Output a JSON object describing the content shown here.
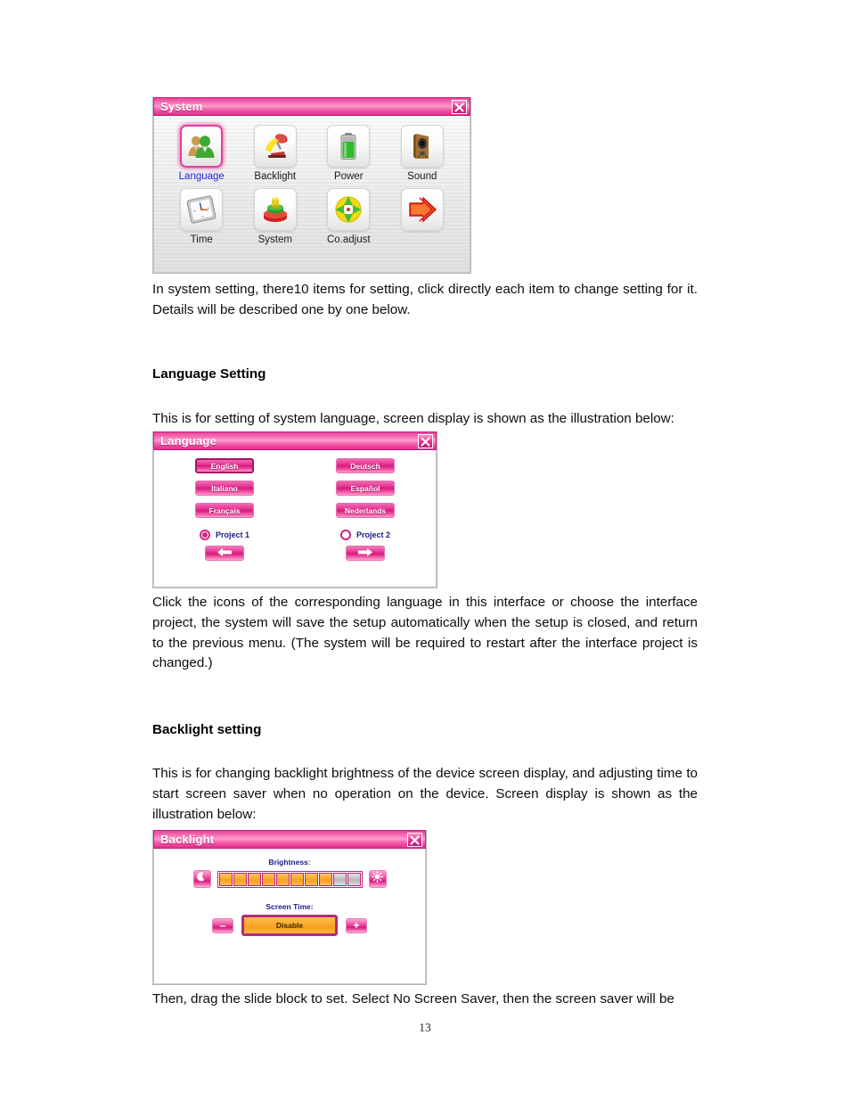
{
  "document": {
    "page_number": "13"
  },
  "system_dialog": {
    "title": "System",
    "close_label": "×",
    "items": [
      {
        "label": "Language",
        "icon": "people-icon",
        "selected": true,
        "highlight": true
      },
      {
        "label": "Backlight",
        "icon": "desk-lamp-icon",
        "selected": false,
        "highlight": false
      },
      {
        "label": "Power",
        "icon": "battery-icon",
        "selected": false,
        "highlight": false
      },
      {
        "label": "Sound",
        "icon": "speaker-icon",
        "selected": false,
        "highlight": false
      },
      {
        "label": "Time",
        "icon": "clock-icon",
        "selected": false,
        "highlight": false
      },
      {
        "label": "System",
        "icon": "stacked-disks-icon",
        "selected": false,
        "highlight": false
      },
      {
        "label": "Co.adjust",
        "icon": "compass-cross-icon",
        "selected": false,
        "highlight": false
      },
      {
        "label": "",
        "icon": "next-arrow-icon",
        "selected": false,
        "highlight": false
      }
    ]
  },
  "paragraph_system": "In system setting, there10 items for setting, click directly each item to change setting for it. Details will be described one by one below.",
  "language_section": {
    "heading": "Language Setting",
    "intro": "This is for setting of system language, screen display is shown as the illustration below:",
    "after": "Click the icons of the corresponding language in this interface or choose the interface project, the system will save the setup automatically when the setup is closed, and return to the previous menu. (The system will be required to restart after the interface project is changed.)"
  },
  "language_dialog": {
    "title": "Language",
    "close_label": "×",
    "buttons": [
      {
        "label": "English",
        "selected": true
      },
      {
        "label": "Deutsch",
        "selected": false
      },
      {
        "label": "Italiano",
        "selected": false
      },
      {
        "label": "Español",
        "selected": false
      },
      {
        "label": "Français",
        "selected": false
      },
      {
        "label": "Nederlands",
        "selected": false
      }
    ],
    "projects": [
      {
        "label": "Project 1",
        "selected": true
      },
      {
        "label": "Project 2",
        "selected": false
      }
    ],
    "nav": {
      "prev_icon": "left-arrow-icon",
      "next_icon": "right-arrow-icon"
    }
  },
  "backlight_section": {
    "heading": "Backlight setting",
    "intro": "This is for changing backlight brightness of the device screen display, and adjusting time to start screen saver when no operation on the device. Screen display is shown as the illustration below:",
    "after": "Then, drag the slide block to set. Select No Screen Saver, then the screen saver will be"
  },
  "backlight_dialog": {
    "title": "Backlight",
    "close_label": "×",
    "brightness_label": "Brightness:",
    "brightness_segments_total": 10,
    "brightness_segments_filled": 8,
    "dim_icon": "moon-icon",
    "bright_icon": "sun-icon",
    "screen_time_label": "Screen Time:",
    "screen_time_value": "Disable",
    "decrease_label": "–",
    "increase_label": "+"
  },
  "colors": {
    "accent_pink": "#d81a80",
    "title_pink": "#e8439a",
    "slider_orange": "#f9a01e",
    "label_blue": "#1b1b8c",
    "link_blue": "#2222dd"
  }
}
